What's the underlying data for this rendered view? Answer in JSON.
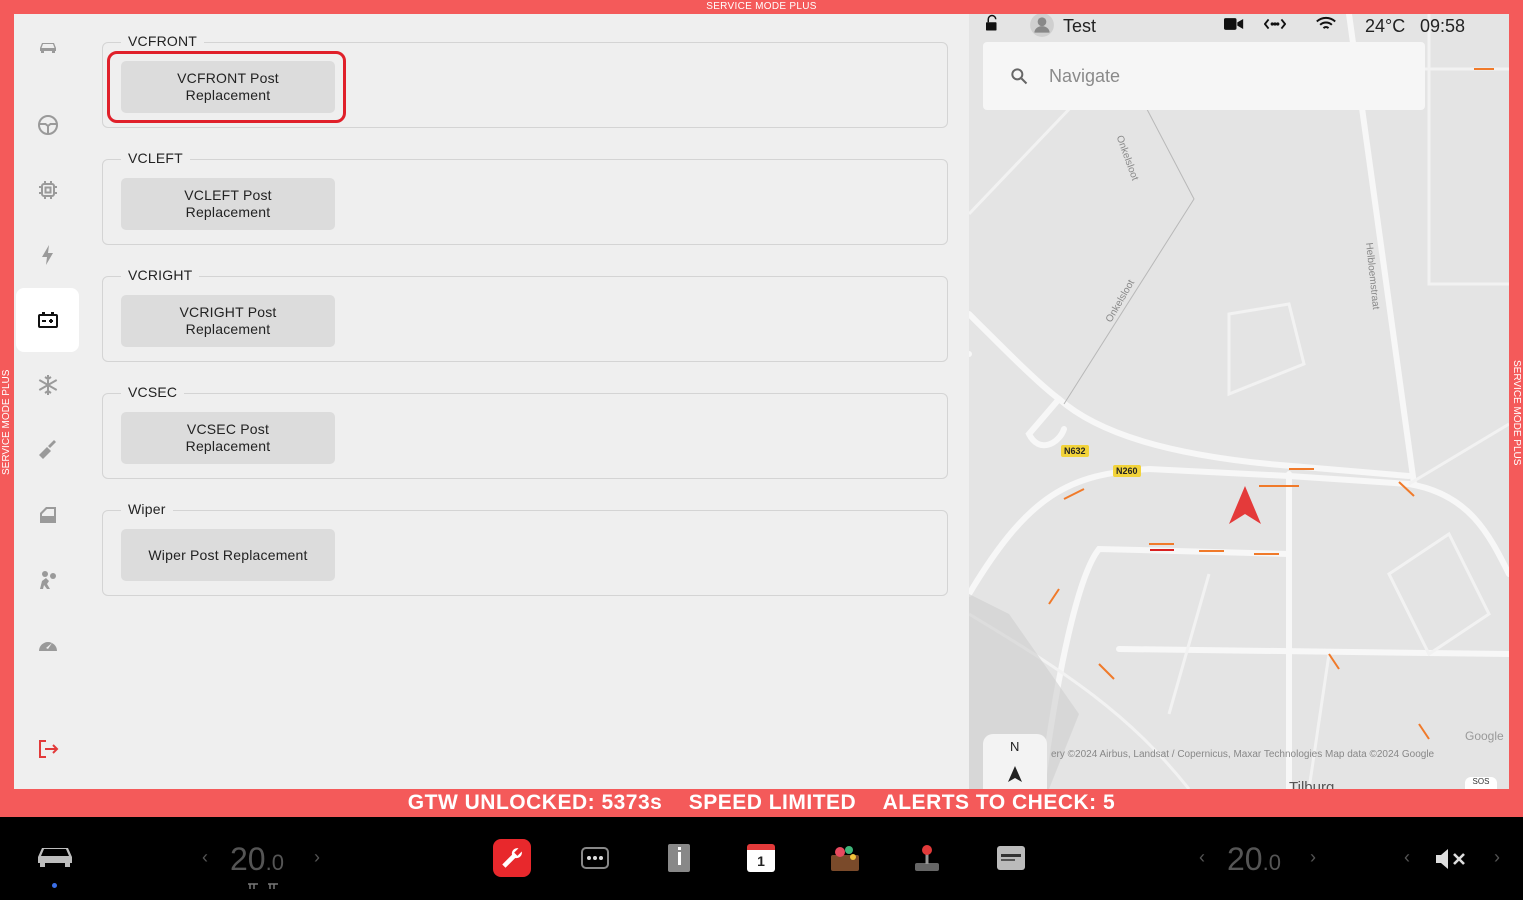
{
  "frame": {
    "top_label": "SERVICE MODE PLUS",
    "side_label": "SERVICE MODE PLUS",
    "status": {
      "gtw": "GTW UNLOCKED: 5373s",
      "speed": "SPEED LIMITED",
      "alerts": "ALERTS TO CHECK: 5"
    }
  },
  "sidebar": {
    "items": [
      {
        "icon": "car-icon"
      },
      {
        "icon": "steering-wheel-icon"
      },
      {
        "icon": "chip-icon"
      },
      {
        "icon": "lightning-icon"
      },
      {
        "icon": "battery-icon",
        "active": true
      },
      {
        "icon": "snowflake-icon"
      },
      {
        "icon": "wrench-icon"
      },
      {
        "icon": "door-icon"
      },
      {
        "icon": "airbag-icon"
      },
      {
        "icon": "speedometer-icon"
      },
      {
        "icon": "exit-icon"
      }
    ]
  },
  "sections": [
    {
      "title": "VCFRONT",
      "button": "VCFRONT Post Replacement",
      "highlighted": true
    },
    {
      "title": "VCLEFT",
      "button": "VCLEFT Post Replacement"
    },
    {
      "title": "VCRIGHT",
      "button": "VCRIGHT Post Replacement"
    },
    {
      "title": "VCSEC",
      "button": "VCSEC Post Replacement"
    },
    {
      "title": "Wiper",
      "button": "Wiper Post Replacement"
    }
  ],
  "map": {
    "profile_name": "Test",
    "temperature": "24°C",
    "time": "09:58",
    "search_placeholder": "Navigate",
    "streets": [
      "Onkelsloot",
      "Onkelsloot",
      "Helbloemstraat"
    ],
    "shields": [
      "N632",
      "N260"
    ],
    "city": "Tilburg",
    "attribution": "ery ©2024 Airbus, Landsat / Copernicus, Maxar Technologies Map data ©2024 Google",
    "google": "Google",
    "sos": "SOS",
    "compass": "N"
  },
  "taskbar": {
    "left_temp_int": "20",
    "left_temp_dec": ".0",
    "right_temp_int": "20",
    "right_temp_dec": ".0",
    "calendar_day": "1",
    "colors": {
      "service_red": "#f45a5a",
      "wrench_app": "#e8282c",
      "accent_red": "#e0202a"
    }
  }
}
